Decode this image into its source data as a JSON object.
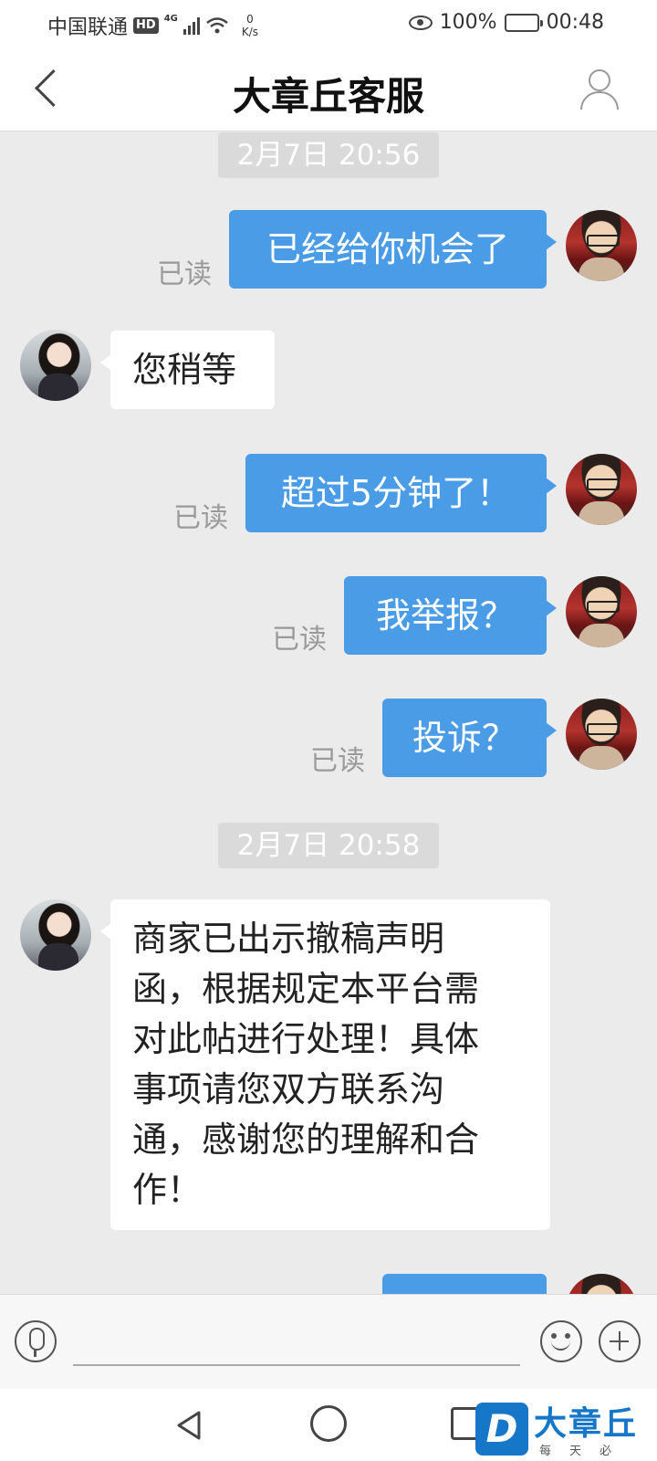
{
  "status_bar": {
    "carrier": "中国联通",
    "hd": "HD",
    "network": "4G",
    "speed_value": "0",
    "speed_unit": "K/s",
    "battery": "100%",
    "time": "00:48"
  },
  "header": {
    "title": "大章丘客服"
  },
  "chat": {
    "timestamps": [
      "2月7日 20:56",
      "2月7日 20:58"
    ],
    "read_label": "已读",
    "messages": [
      {
        "from": "me",
        "text": "已经给你机会了"
      },
      {
        "from": "agent",
        "text": "您稍等"
      },
      {
        "from": "me",
        "text": "超过5分钟了！"
      },
      {
        "from": "me",
        "text": "我举报？"
      },
      {
        "from": "me",
        "text": "投诉？"
      },
      {
        "from": "agent",
        "lines": [
          "商家已出示撤稿声明",
          "函，根据规定本平台需",
          "对此帖进行处理！具体",
          "事项请您双方联系沟",
          "通，感谢您的理解和合",
          "作！"
        ]
      }
    ]
  },
  "input_bar": {
    "placeholder": ""
  },
  "watermark": {
    "logo_letter": "D",
    "name": "大章丘",
    "slogan": "每天必看"
  },
  "colors": {
    "outgoing_bubble": "#4a9ce6",
    "chat_background": "#ebebeb"
  }
}
